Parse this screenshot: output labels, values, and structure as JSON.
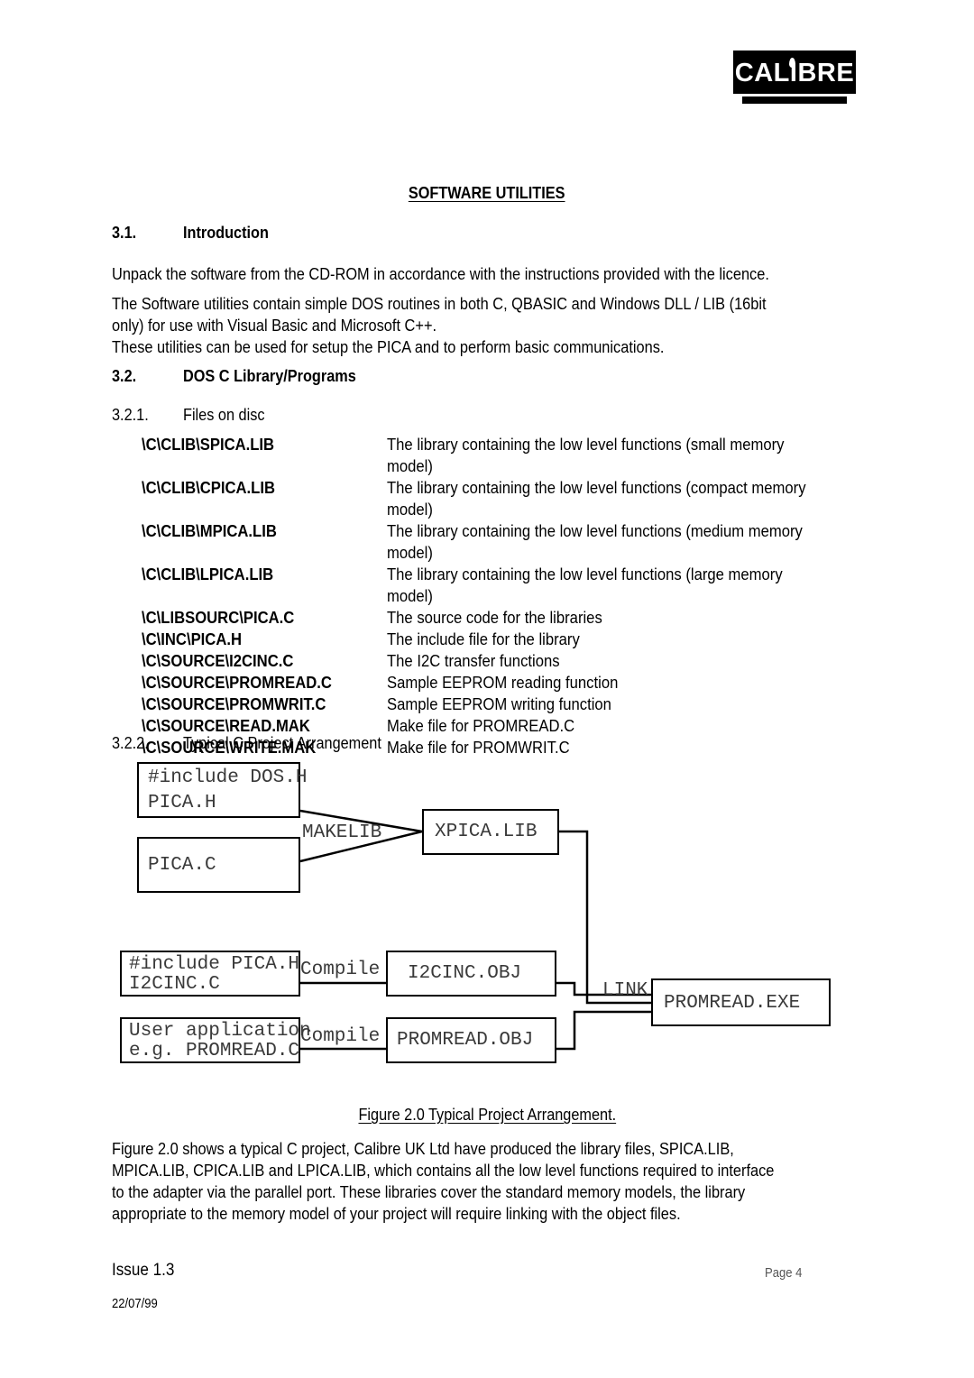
{
  "logo": {
    "text": "CALIBRE",
    "flame_icon": "flame-dot-icon"
  },
  "document": {
    "title": "SOFTWARE UTILITIES",
    "sections": {
      "intro": {
        "number": "3.1.",
        "title": "Introduction",
        "paragraphs": [
          "Unpack the software from the CD-ROM in accordance with the instructions provided with the licence.",
          "The Software utilities contain simple DOS routines in both C, QBASIC and Windows DLL / LIB (16bit\nonly) for use with Visual Basic and Microsoft C++.",
          "These utilities can be used for setup the PICA and to perform basic communications."
        ]
      },
      "dos_c": {
        "number": "3.2.",
        "title": "DOS C Library/Programs"
      },
      "files_on_disc": {
        "number": "3.2.1.",
        "title": "Files on disc"
      },
      "typical_project": {
        "number": "3.2.2.",
        "title": "Typical C Project Arrangement"
      }
    }
  },
  "files": [
    {
      "name": "\\C\\CLIB\\SPICA.LIB",
      "desc": "The library containing the low level functions (small memory model)"
    },
    {
      "name": "\\C\\CLIB\\CPICA.LIB",
      "desc": "The library containing the low level functions (compact memory model)"
    },
    {
      "name": "\\C\\CLIB\\MPICA.LIB",
      "desc": "The library containing the low level functions (medium memory model)"
    },
    {
      "name": "\\C\\CLIB\\LPICA.LIB",
      "desc": "The library containing the low level functions (large memory model)"
    },
    {
      "name": "\\C\\LIBSOURC\\PICA.C",
      "desc": "The source code for the libraries"
    },
    {
      "name": "\\C\\INC\\PICA.H",
      "desc": "The include file for the library"
    },
    {
      "name": "\\C\\SOURCE\\I2CINC.C",
      "desc": "The I2C transfer functions"
    },
    {
      "name": "\\C\\SOURCE\\PROMREAD.C",
      "desc": "Sample EEPROM reading function"
    },
    {
      "name": "\\C\\SOURCE\\PROMWRIT.C",
      "desc": "Sample EEPROM writing function"
    },
    {
      "name": "\\C\\SOURCE\\READ.MAK",
      "desc": "Make file for PROMREAD.C"
    },
    {
      "name": "\\C\\SOURCE\\WRITE.MAK",
      "desc": "Make file for PROMWRIT.C"
    }
  ],
  "diagram": {
    "boxes": {
      "includes": {
        "line1": "#include DOS.H",
        "line2": "PICA.H"
      },
      "pica_c": {
        "line1": "PICA.C"
      },
      "xpica_lib": {
        "line1": "XPICA.LIB"
      },
      "i2cinc_c": {
        "line1": "#include PICA.H",
        "line2": "I2CINC.C"
      },
      "user_app": {
        "line1": "User application",
        "line2": "e.g. PROMREAD.C"
      },
      "i2cinc_obj": {
        "line1": "I2CINC.OBJ"
      },
      "promread_obj": {
        "line1": "PROMREAD.OBJ"
      },
      "promread_exe": {
        "line1": "PROMREAD.EXE"
      }
    },
    "labels": {
      "makelib": "MAKELIB",
      "compile_top": "Compile",
      "compile_bottom": "Compile",
      "link": "LINK"
    }
  },
  "figure": {
    "caption": "Figure 2.0 Typical Project Arrangement.",
    "body": "Figure 2.0 shows a typical C project, Calibre UK Ltd have produced the library files, SPICA.LIB,\nMPICA.LIB, CPICA.LIB and LPICA.LIB, which contains all the low level functions required to interface\nto the adapter via the parallel port. These libraries cover the standard memory models, the library\nappropriate to the memory model of your project will require linking with the object files."
  },
  "footer": {
    "issue": "Issue 1.3",
    "date": "22/07/99",
    "page": "Page 4"
  }
}
